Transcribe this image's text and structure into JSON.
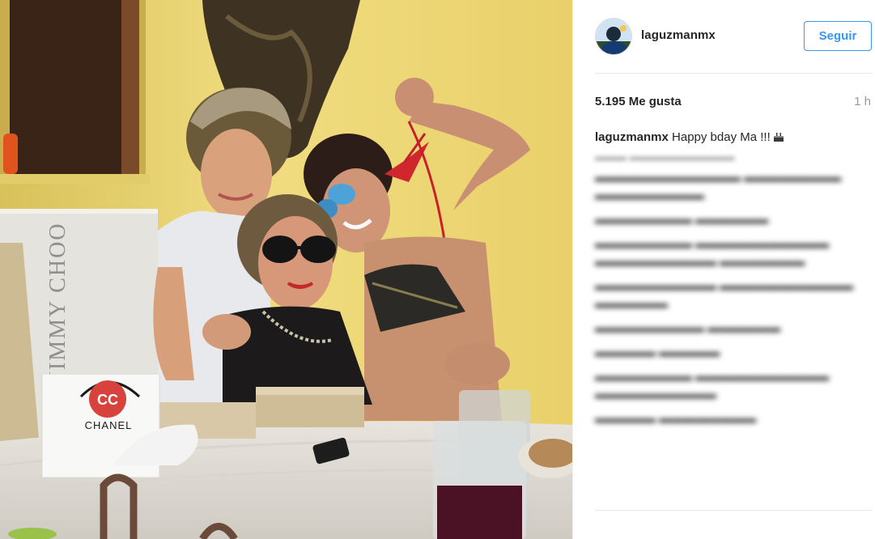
{
  "header": {
    "username": "laguzmanmx",
    "follow_label": "Seguir"
  },
  "stats": {
    "likes": "5.195 Me gusta",
    "time": "1 h"
  },
  "caption": {
    "user": "laguzmanmx",
    "text": "Happy bday Ma !!!"
  },
  "photo": {
    "bag_brand": "JIMMY CHOO",
    "box_brand": "CHANEL"
  }
}
